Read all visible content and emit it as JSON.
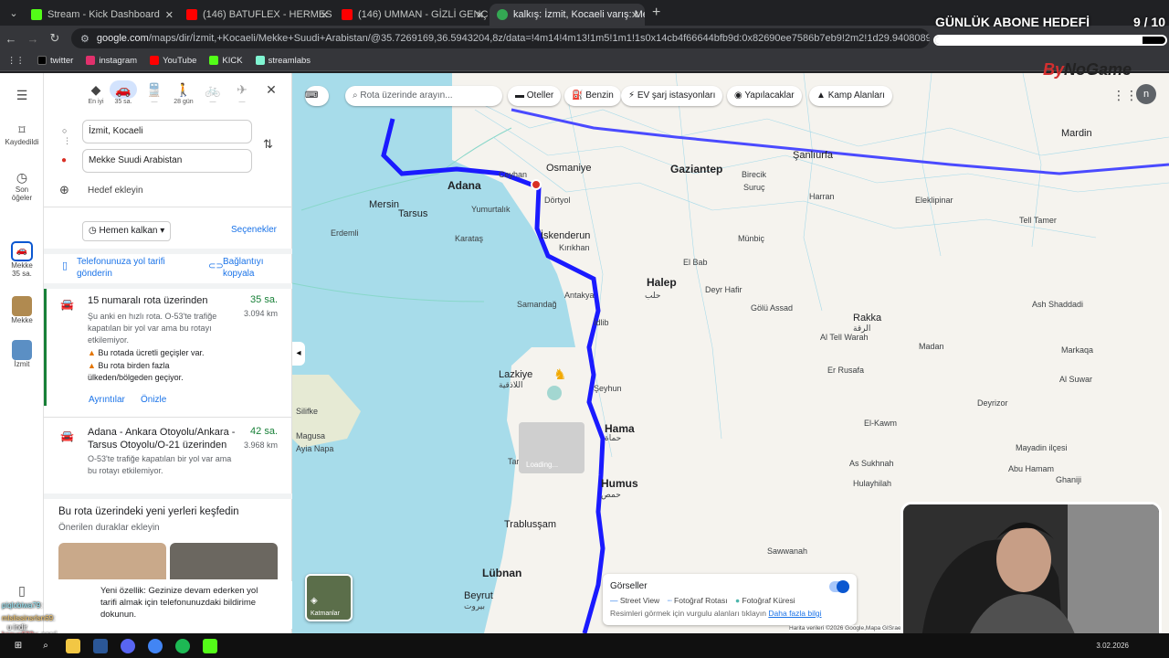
{
  "tabs": [
    {
      "label": "Stream - Kick Dashboard",
      "color": "#53fc18"
    },
    {
      "label": "(146) BATUFLEX - HERMES 2.0 ..",
      "color": "#ff0000"
    },
    {
      "label": "(146) UMMAN - GİZLİ GENÇ",
      "color": "#ff0000"
    },
    {
      "label": "kalkış: İzmit, Kocaeli varış: Mekke",
      "color": "#34a853"
    }
  ],
  "omnibox": {
    "host": "google.com",
    "path": "/maps/dir/İzmit,+Kocaeli/Mekke+Suudi+Arabistan/@35.7269169,36.5943204,8z/data=!4m14!4m13!1m5!1m1!1s0x14cb4f66644bfb9d:0x82690ee7586b7eb9!2m2!1d29.9408089!2d40.7654408!1m5!1m1!1s0x15c2"
  },
  "bookmarks": [
    {
      "label": "twitter",
      "color": "#000000"
    },
    {
      "label": "instagram",
      "color": "#e1306c"
    },
    {
      "label": "YouTube",
      "color": "#ff0000"
    },
    {
      "label": "KICK",
      "color": "#53fc18"
    },
    {
      "label": "streamlabs",
      "color": "#80f5d2"
    }
  ],
  "goal": {
    "title": "GÜNLÜK ABONE HEDEFİ",
    "count": "9  / 10",
    "progress": 0.9
  },
  "brand": {
    "a": "By",
    "b": "NoGame"
  },
  "rail": {
    "saved": "Kaydedildi",
    "history": "Son öğeler",
    "recent1_line1": "Mekke",
    "recent1_line2": "35 sa.",
    "recent2": "Mekke",
    "recent3": "İzmit"
  },
  "modes": [
    {
      "icon": "◆",
      "label": "En iyi"
    },
    {
      "icon": "🚗",
      "label": "35 sa."
    },
    {
      "icon": "🚆",
      "label": "—"
    },
    {
      "icon": "🚶",
      "label": "28 gün"
    },
    {
      "icon": "🚲",
      "label": "—"
    },
    {
      "icon": "✈",
      "label": "—"
    }
  ],
  "origin": "İzmit, Kocaeli",
  "destination": "Mekke Suudi Arabistan",
  "add_destination": "Hedef ekleyin",
  "depart_label": "Hemen kalkan",
  "options_label": "Seçenekler",
  "send_phone": "Telefonunuza yol tarifi gönderin",
  "copy_link": "Bağlantıyı kopyala",
  "routes": [
    {
      "title": "15 numaralı rota üzerinden",
      "time": "35 sa.",
      "distance": "3.094 km",
      "desc": "Şu anki en hızlı rota. O-53'te trafiğe kapatılan bir yol var ama bu rotayı etkilemiyor.",
      "warn1": "Bu rotada ücretli geçişler var.",
      "warn2": "Bu rota birden fazla ülkeden/bölgeden geçiyor.",
      "details": "Ayrıntılar",
      "preview": "Önizle"
    },
    {
      "title": "Adana - Ankara Otoyolu/Ankara - Tarsus Otoyolu/O-21 üzerinden",
      "time": "42 sa.",
      "distance": "3.968 km",
      "desc": "O-53'te trafiğe kapatılan bir yol var ama bu rotayı etkilemiyor."
    }
  ],
  "explore": {
    "title": "Bu rota üzerindeki yeni yerleri keşfedin",
    "sub": "Önerilen duraklar ekleyin"
  },
  "toast": "Yeni özellik: Gezinize devam ederken yol tarifi almak için telefonunuzdaki bildirime dokunun.",
  "map_search_placeholder": "Rota üzerinde arayın...",
  "chips": [
    "Oteller",
    "Benzin",
    "EV şarj istasyonları",
    "Yapılacaklar",
    "Kamp Alanları"
  ],
  "places": [
    {
      "n": "Adana",
      "c": "big"
    },
    {
      "n": "Mersin",
      "c": "mid"
    },
    {
      "n": "Tarsus",
      "c": "mid"
    },
    {
      "n": "Osmaniye",
      "c": "mid"
    },
    {
      "n": "Gaziantep",
      "c": "big"
    },
    {
      "n": "Şanlıurfa",
      "c": "mid"
    },
    {
      "n": "Mardin",
      "c": "mid"
    },
    {
      "n": "İskenderun",
      "c": "mid"
    },
    {
      "n": "Halep",
      "c": "big"
    },
    {
      "n": "حلب",
      "c": ""
    },
    {
      "n": "Rakka",
      "c": "mid"
    },
    {
      "n": "الرقة",
      "c": ""
    },
    {
      "n": "Lazkiye",
      "c": "mid"
    },
    {
      "n": "اللاذقية",
      "c": ""
    },
    {
      "n": "Hama",
      "c": "big"
    },
    {
      "n": "حماة",
      "c": ""
    },
    {
      "n": "Humus",
      "c": "big"
    },
    {
      "n": "حمص",
      "c": ""
    },
    {
      "n": "Trablusşam",
      "c": "mid"
    },
    {
      "n": "Lübnan",
      "c": "big"
    },
    {
      "n": "Beyrut",
      "c": "mid"
    },
    {
      "n": "بيروت",
      "c": ""
    },
    {
      "n": "Tell Tamer",
      "c": ""
    },
    {
      "n": "El Bab",
      "c": ""
    },
    {
      "n": "Deyr Hafir",
      "c": ""
    },
    {
      "n": "Gölü Assad",
      "c": ""
    },
    {
      "n": "Er Rusafa",
      "c": ""
    },
    {
      "n": "Ash Shaddadi",
      "c": ""
    },
    {
      "n": "Madan",
      "c": ""
    },
    {
      "n": "Deyrizor",
      "c": ""
    },
    {
      "n": "El-Kawm",
      "c": ""
    },
    {
      "n": "As Sukhnah",
      "c": ""
    },
    {
      "n": "Hulayhilah",
      "c": ""
    },
    {
      "n": "Mayadin ilçesi",
      "c": ""
    },
    {
      "n": "Abu Hamam",
      "c": ""
    },
    {
      "n": "Şeyhun",
      "c": ""
    },
    {
      "n": "Münbiç",
      "c": ""
    },
    {
      "n": "Erdemli",
      "c": ""
    },
    {
      "n": "Silifke",
      "c": ""
    },
    {
      "n": "Yumurtalık",
      "c": ""
    },
    {
      "n": "Karataş",
      "c": ""
    },
    {
      "n": "Samandağ",
      "c": ""
    },
    {
      "n": "Antakya",
      "c": ""
    },
    {
      "n": "Kırıkhan",
      "c": ""
    },
    {
      "n": "İdlib",
      "c": ""
    },
    {
      "n": "Ceyhan",
      "c": ""
    },
    {
      "n": "Dörtyol",
      "c": ""
    },
    {
      "n": "Birecik",
      "c": ""
    },
    {
      "n": "Suruç",
      "c": ""
    },
    {
      "n": "Harran",
      "c": ""
    },
    {
      "n": "Eleklipinar",
      "c": ""
    },
    {
      "n": "Ayia Napa",
      "c": ""
    },
    {
      "n": "Sawwanah",
      "c": ""
    },
    {
      "n": "Al Suwar",
      "c": ""
    },
    {
      "n": "Ghaniji",
      "c": ""
    },
    {
      "n": "Markaqa",
      "c": ""
    },
    {
      "n": "Al Tell Warah",
      "c": ""
    },
    {
      "n": "Tar",
      "c": ""
    },
    {
      "n": "Magusa",
      "c": ""
    }
  ],
  "streetview_card": {
    "title": "Görseller",
    "legend": [
      "Street View",
      "Fotoğraf Rotası",
      "Fotoğraf Küresi"
    ],
    "hint": "Resimleri görmek için vurgulu alanları tıklayın",
    "more": "Daha fazla bilgi"
  },
  "layers_label": "Katmanlar",
  "loading": "Loading...",
  "attribution": "Harita verileri ©2026 Google,Mapa GISrael",
  "chat": [
    {
      "user": "piqlobiwa79",
      "msg": ":"
    },
    {
      "user": "mlslissinsrlsn69",
      "msg": ":"
    },
    {
      "user": "u indir",
      "msg": ""
    },
    {
      "user": "kanye622y",
      "msg": ": nasıl"
    }
  ],
  "clock": "3.02.2026"
}
